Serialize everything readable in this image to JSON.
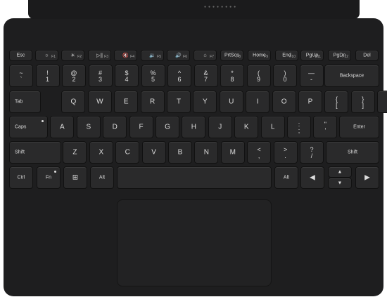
{
  "keyboard": {
    "fn_row": [
      {
        "id": "esc",
        "label": "Esc"
      },
      {
        "id": "f1",
        "label": "☼",
        "sub": "F1"
      },
      {
        "id": "f2",
        "label": "☀",
        "sub": "F2"
      },
      {
        "id": "f3",
        "label": "▷||",
        "sub": "F3"
      },
      {
        "id": "f4",
        "label": "🔇",
        "sub": "F4"
      },
      {
        "id": "f5",
        "label": "🔉",
        "sub": "F5"
      },
      {
        "id": "f6",
        "label": "🔊",
        "sub": "F6"
      },
      {
        "id": "f7",
        "label": "⌂",
        "sub": "F7"
      },
      {
        "id": "prtscn",
        "label": "PrtScn",
        "sub": "F8"
      },
      {
        "id": "home",
        "label": "Home",
        "sub": "F9"
      },
      {
        "id": "end",
        "label": "End",
        "sub": "F10"
      },
      {
        "id": "pgup",
        "label": "PgUp",
        "sub": "F11"
      },
      {
        "id": "pgdn",
        "label": "PgDn",
        "sub": "F12"
      },
      {
        "id": "del",
        "label": "Del"
      }
    ],
    "number_row": [
      {
        "top": "~",
        "bot": "`"
      },
      {
        "top": "!",
        "bot": "1"
      },
      {
        "top": "@",
        "bot": "2"
      },
      {
        "top": "#",
        "bot": "3"
      },
      {
        "top": "$",
        "bot": "4"
      },
      {
        "top": "%",
        "bot": "5"
      },
      {
        "top": "^",
        "bot": "6"
      },
      {
        "top": "&",
        "bot": "7"
      },
      {
        "top": "*",
        "bot": "8"
      },
      {
        "top": "(",
        "bot": "9"
      },
      {
        "top": ")",
        "bot": "0"
      },
      {
        "top": "—",
        "bot": "-"
      },
      {
        "top": "+",
        "bot": "="
      },
      {
        "label": "Backspace"
      }
    ],
    "qwerty_row": [
      {
        "label": "Tab"
      },
      {
        "label": "Q"
      },
      {
        "label": "W"
      },
      {
        "label": "E"
      },
      {
        "label": "R"
      },
      {
        "label": "T"
      },
      {
        "label": "Y"
      },
      {
        "label": "U"
      },
      {
        "label": "I"
      },
      {
        "label": "O"
      },
      {
        "label": "P"
      },
      {
        "top": "{",
        "bot": "["
      },
      {
        "top": "}",
        "bot": "]"
      },
      {
        "top": "|",
        "bot": "\\"
      }
    ],
    "home_row": [
      {
        "label": "Caps"
      },
      {
        "label": "A"
      },
      {
        "label": "S"
      },
      {
        "label": "D"
      },
      {
        "label": "F"
      },
      {
        "label": "G"
      },
      {
        "label": "H"
      },
      {
        "label": "J"
      },
      {
        "label": "K"
      },
      {
        "label": "L"
      },
      {
        "top": ":",
        "bot": ";"
      },
      {
        "top": "\"",
        "bot": "'"
      },
      {
        "label": "Enter"
      }
    ],
    "shift_row": [
      {
        "label": "Shift"
      },
      {
        "label": "Z"
      },
      {
        "label": "X"
      },
      {
        "label": "C"
      },
      {
        "label": "V"
      },
      {
        "label": "B"
      },
      {
        "label": "N"
      },
      {
        "label": "M"
      },
      {
        "top": "<",
        "bot": ","
      },
      {
        "top": ">",
        "bot": "."
      },
      {
        "top": "?",
        "bot": "/"
      },
      {
        "label": "Shift"
      }
    ],
    "bottom_row": [
      {
        "id": "ctrl",
        "label": "Ctrl"
      },
      {
        "id": "fn",
        "label": "Fn"
      },
      {
        "id": "win",
        "label": "⊞"
      },
      {
        "id": "alt-left",
        "label": "Alt"
      },
      {
        "id": "space",
        "label": ""
      },
      {
        "id": "alt-right",
        "label": "Alt"
      },
      {
        "id": "left",
        "label": "◀"
      },
      {
        "id": "up",
        "label": "▲"
      },
      {
        "id": "down",
        "label": "▼"
      },
      {
        "id": "right",
        "label": "▶"
      }
    ]
  }
}
